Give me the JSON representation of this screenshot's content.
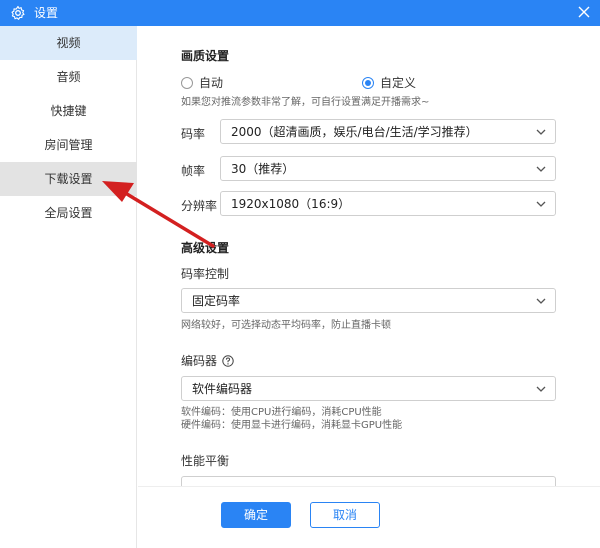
{
  "window": {
    "title": "设置",
    "accent": "#2a84f4"
  },
  "sidebar": {
    "items": [
      {
        "label": "视频"
      },
      {
        "label": "音频"
      },
      {
        "label": "快捷键"
      },
      {
        "label": "房间管理"
      },
      {
        "label": "下载设置"
      },
      {
        "label": "全局设置"
      }
    ],
    "active_index": 0,
    "hover_index": 4
  },
  "quality": {
    "title": "画质设置",
    "mode_auto": "自动",
    "mode_custom": "自定义",
    "selected_mode": "自定义",
    "hint": "如果您对推流参数非常了解，可自行设置满足开播需求~",
    "bitrate": {
      "label": "码率",
      "value": "2000（超清画质，娱乐/电台/生活/学习推荐）"
    },
    "framerate": {
      "label": "帧率",
      "value": "30（推荐）"
    },
    "resolution": {
      "label": "分辨率",
      "value": "1920x1080（16:9）"
    }
  },
  "advanced": {
    "title": "高级设置",
    "rate_control": {
      "label": "码率控制",
      "value": "固定码率",
      "hint": "网络较好，可选择动态平均码率，防止直播卡顿"
    },
    "encoder": {
      "label": "编码器",
      "value": "软件编码器",
      "hint1": "软件编码：使用CPU进行编码，消耗CPU性能",
      "hint2": "硬件编码：使用显卡进行编码，消耗显卡GPU性能"
    },
    "performance": {
      "label": "性能平衡"
    }
  },
  "footer": {
    "confirm": "确定",
    "cancel": "取消"
  },
  "icons": {
    "title": "gear-icon",
    "close": "close-icon",
    "dropdown": "chevron-down-icon",
    "help": "help-circle-icon",
    "annotation": "red-arrow-annotation"
  },
  "colors": {
    "active_item_bg": "#dcebfa",
    "hover_item_bg": "#e3e3e3",
    "annotation": "#d32020"
  }
}
